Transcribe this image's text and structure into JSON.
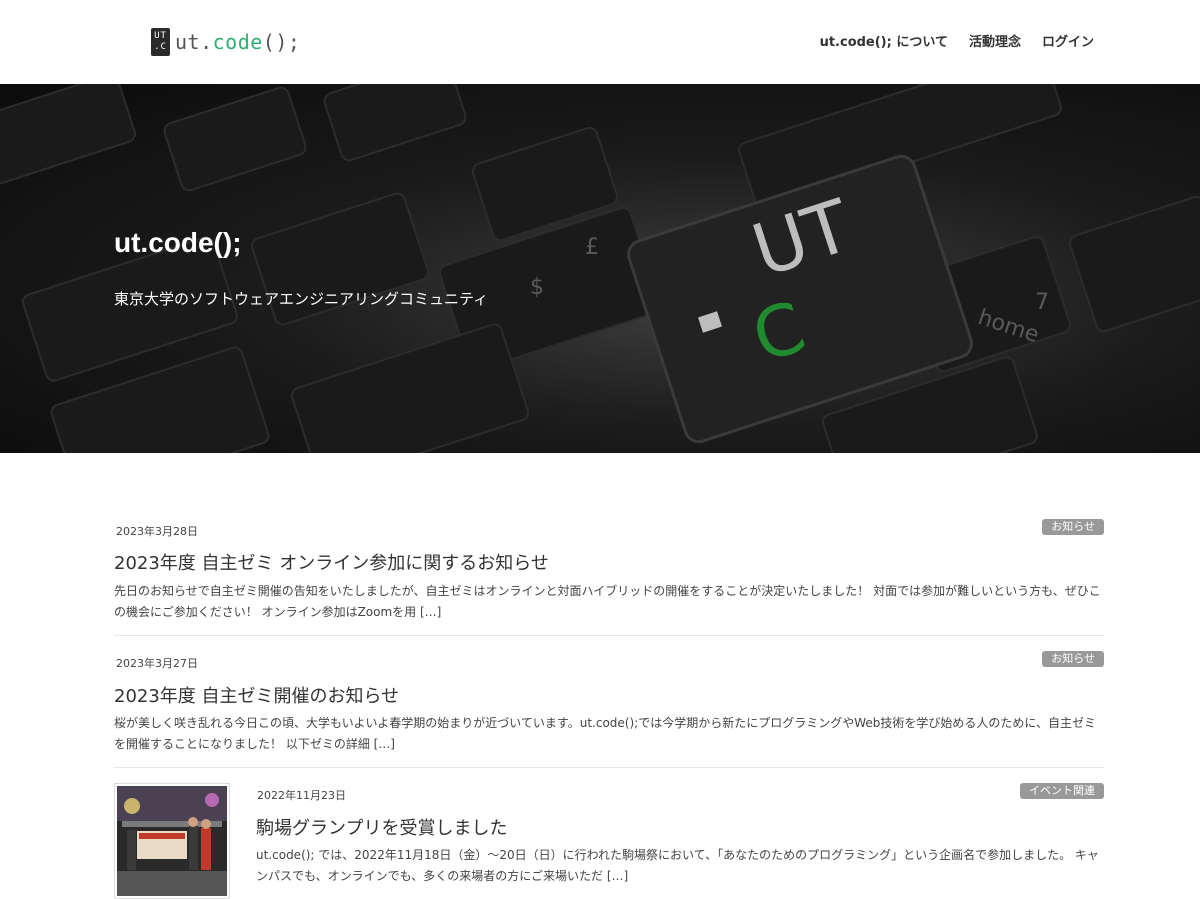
{
  "header": {
    "logo_badge_top": "UT",
    "logo_badge_bottom": ".C",
    "logo_prefix": "ut.",
    "logo_code": "code",
    "logo_suffix": "();",
    "nav": [
      "ut.code(); について",
      "活動理念",
      "ログイン"
    ]
  },
  "hero": {
    "title": "ut.code();",
    "subtitle": "東京大学のソフトウェアエンジニアリングコミュニティ"
  },
  "posts": [
    {
      "date": "2023年3月28日",
      "category": "お知らせ",
      "title": "2023年度 自主ゼミ オンライン参加に関するお知らせ",
      "excerpt": "先日のお知らせで自主ゼミ開催の告知をいたしましたが、自主ゼミはオンラインと対面ハイブリッドの開催をすることが決定いたしました！ 対面では参加が難しいという方も、ぜひこの機会にご参加ください！ オンライン参加はZoomを用 […]"
    },
    {
      "date": "2023年3月27日",
      "category": "お知らせ",
      "title": "2023年度 自主ゼミ開催のお知らせ",
      "excerpt": "桜が美しく咲き乱れる今日この頃、大学もいよいよ春学期の始まりが近づいています。ut.code();では今学期から新たにプログラミングやWeb技術を学び始める人のために、自主ゼミを開催することになりました！ 以下ゼミの詳細 […]"
    },
    {
      "date": "2022年11月23日",
      "category": "イベント関連",
      "title": "駒場グランプリを受賞しました",
      "excerpt": "ut.code(); では、2022年11月18日（金）〜20日（日）に行われた駒場祭において、「あなたのためのプログラミング」という企画名で参加しました。 キャンパスでも、オンラインでも、多くの来場者の方にご来場いただ […]"
    }
  ]
}
